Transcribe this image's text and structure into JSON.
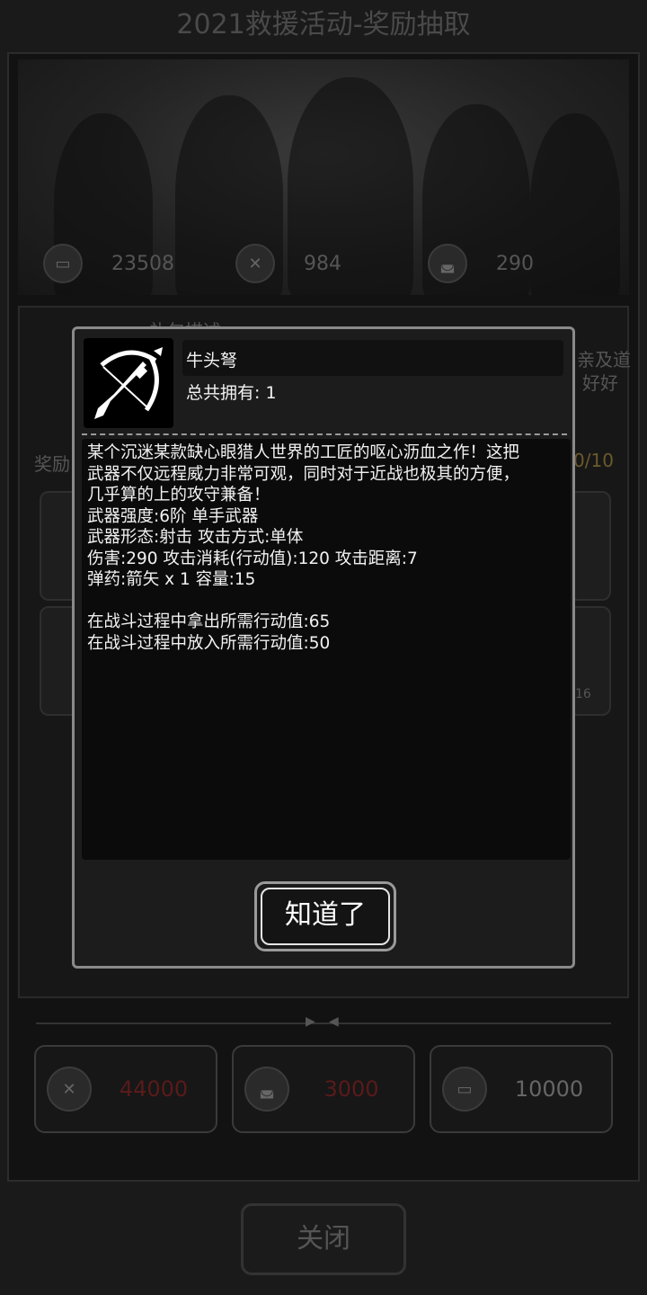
{
  "header": {
    "title": "2021救援活动-奖励抽取"
  },
  "stats": [
    {
      "icon": "card-icon",
      "value": "23508"
    },
    {
      "icon": "crossed-tools-icon",
      "value": "984"
    },
    {
      "icon": "car-icon",
      "value": "290"
    }
  ],
  "background_texts": {
    "section_label": "奖励",
    "description_title": "礼包描述",
    "right_text_1": "亲及道",
    "right_text_2": "好好",
    "counter": "0/10",
    "small_badge": "16"
  },
  "costs": [
    {
      "icon": "crossed-tools-icon",
      "value": "44000",
      "color": "#5a1a1a"
    },
    {
      "icon": "car-icon",
      "value": "3000",
      "color": "#5a1a1a"
    },
    {
      "icon": "card-icon",
      "value": "10000",
      "color": "#666666"
    }
  ],
  "footer": {
    "close_label": "关闭"
  },
  "modal": {
    "item_icon": "crossbow-icon",
    "item_name": "牛头弩",
    "owned_label": "总共拥有:  1",
    "description_lines": [
      "某个沉迷某款缺心眼猎人世界的工匠的呕心沥血之作！这把",
      "武器不仅远程威力非常可观，同时对于近战也极其的方便，",
      "几乎算的上的攻守兼备！",
      "武器强度:6阶 单手武器",
      "武器形态:射击 攻击方式:单体",
      "伤害:290 攻击消耗(行动值):120 攻击距离:7",
      "弹药:箭矢 x 1 容量:15",
      "",
      "在战斗过程中拿出所需行动值:65",
      "在战斗过程中放入所需行动值:50"
    ],
    "ok_label": "知道了"
  }
}
